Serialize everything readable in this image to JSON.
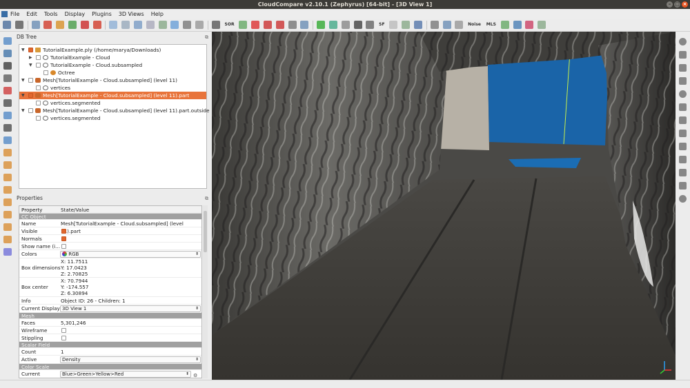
{
  "window": {
    "title": "CloudCompare v2.10.1 (Zephyrus) [64-bit] - [3D View 1]"
  },
  "menu": [
    "File",
    "Edit",
    "Tools",
    "Display",
    "Plugins",
    "3D Views",
    "Help"
  ],
  "toolbar": {
    "sor_label": "SOR",
    "sf_label": "SF",
    "noise_label": "Noise",
    "mls_label": "MLS",
    "icons": [
      "new-folder-icon",
      "save-icon",
      "pick-center-icon",
      "translate-icon",
      "segment-icon",
      "merge-icon",
      "delete-icon",
      "sample-icon",
      "delete-scalar-icon",
      "cloud-points-icon",
      "compute-normals-icon",
      "orient-icon",
      "distance-icon",
      "align-icon",
      "register-icon",
      "mesh-icon",
      "grid-icon",
      "sor-filter-icon",
      "check-icon",
      "pick-icon",
      "cross-section-icon",
      "red-square-icon",
      "cut-icon",
      "dip-icon",
      "histogram-icon",
      "filter-icon",
      "cylinder-icon",
      "plus-icon",
      "gradient-icon",
      "sf-arithmetic-icon",
      "coordinate-icon",
      "rgb-icon",
      "scalar-icon",
      "camera-icon",
      "image-icon",
      "sphere-icon",
      "noise-icon",
      "mls-icon",
      "poisson-icon",
      "rasterize-icon",
      "canupo-icon",
      "facets-icon"
    ]
  },
  "db_tree": {
    "title": "DB Tree",
    "items": [
      {
        "label": "TutorialExample.ply (/home/marya/Downloads)",
        "depth": 0,
        "expanded": true,
        "checked": true,
        "type": "folder"
      },
      {
        "label": "TutorialExample - Cloud",
        "depth": 1,
        "expanded": false,
        "checked": false,
        "type": "cloud"
      },
      {
        "label": "TutorialExample - Cloud.subsampled",
        "depth": 1,
        "expanded": true,
        "checked": false,
        "type": "cloud"
      },
      {
        "label": "Octree",
        "depth": 2,
        "expanded": null,
        "checked": false,
        "type": "octree"
      },
      {
        "label": "Mesh[TutorialExample - Cloud.subsampled] (level 11)",
        "depth": 0,
        "expanded": true,
        "checked": false,
        "type": "mesh"
      },
      {
        "label": "vertices",
        "depth": 1,
        "expanded": null,
        "checked": false,
        "type": "cloud"
      },
      {
        "label": "Mesh[TutorialExample - Cloud.subsampled] (level 11).part",
        "depth": 0,
        "expanded": true,
        "checked": true,
        "type": "mesh",
        "selected": true
      },
      {
        "label": "vertices.segmented",
        "depth": 1,
        "expanded": null,
        "checked": false,
        "type": "cloud"
      },
      {
        "label": "Mesh[TutorialExample - Cloud.subsampled] (level 11).part.outside",
        "depth": 0,
        "expanded": true,
        "checked": false,
        "type": "mesh"
      },
      {
        "label": "vertices.segmented",
        "depth": 1,
        "expanded": null,
        "checked": false,
        "type": "cloud"
      }
    ]
  },
  "properties": {
    "title": "Properties",
    "col_property": "Property",
    "col_value": "State/Value",
    "sect_ccobject": "CC Object",
    "name_label": "Name",
    "name_value": "Mesh[TutorialExample - Cloud.subsampled] (level 11).part",
    "visible_label": "Visible",
    "normals_label": "Normals",
    "showname_label": "Show name (i...",
    "colors_label": "Colors",
    "colors_value": "RGB",
    "boxdim_label": "Box dimensions",
    "boxdim_x": "X: 11.7511",
    "boxdim_y": "Y: 17.0423",
    "boxdim_z": "Z: 2.70825",
    "boxcenter_label": "Box center",
    "boxcenter_x": "X: 70.7944",
    "boxcenter_y": "Y: -174.557",
    "boxcenter_z": "Z: 6.30894",
    "info_label": "Info",
    "info_value": "Object ID: 26 - Children: 1",
    "curdisplay_label": "Current Display",
    "curdisplay_value": "3D View 1",
    "sect_mesh": "Mesh",
    "faces_label": "Faces",
    "faces_value": "5,301,246",
    "wireframe_label": "Wireframe",
    "stippling_label": "Stippling",
    "sect_sf": "Scalar Field",
    "count_label": "Count",
    "count_value": "1",
    "active_label": "Active",
    "active_value": "Density",
    "sect_colorscale": "Color Scale",
    "current_label": "Current",
    "current_value": "Blue>Green>Yellow>Red",
    "visible_checked": true,
    "normals_checked": true,
    "showname_checked": false,
    "wireframe_checked": false,
    "stippling_checked": false
  },
  "view3d": {
    "sky_color": "#1a64a8",
    "rock_color": "#4a4946",
    "floor_color": "#3d3b38"
  },
  "colors": {
    "selection": "#e8743b",
    "titlebar": "#3c3b37",
    "section": "#a0a0a0"
  }
}
